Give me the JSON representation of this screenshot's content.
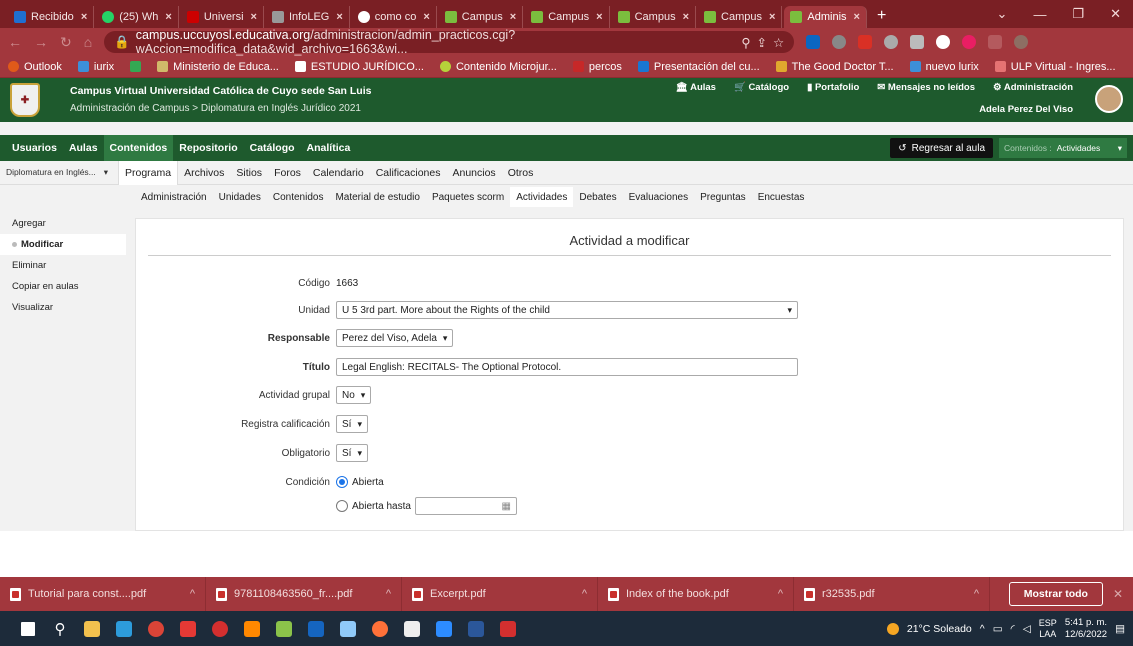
{
  "browser": {
    "tabs": [
      {
        "label": "Recibido",
        "color": "#7a7a7a",
        "active": false
      },
      {
        "label": "(25) Wh",
        "color": "#25d366",
        "active": false
      },
      {
        "label": "Universi",
        "color": "#c00",
        "active": false
      },
      {
        "label": "InfoLEG",
        "color": "#888",
        "active": false
      },
      {
        "label": "como co",
        "color": "#fff",
        "active": false
      },
      {
        "label": "Campus",
        "color": "#5a9e3a",
        "active": false
      },
      {
        "label": "Campus",
        "color": "#5a9e3a",
        "active": false
      },
      {
        "label": "Campus",
        "color": "#5a9e3a",
        "active": false
      },
      {
        "label": "Campus",
        "color": "#5a9e3a",
        "active": false
      },
      {
        "label": "Adminis",
        "color": "#5a9e3a",
        "active": true
      }
    ],
    "url_host": "campus.uccuyosl.educativa.org",
    "url_path": "/administracion/admin_practicos.cgi?wAccion=modifica_data&wid_archivo=1663&wi...",
    "bookmarks": [
      "Outlook",
      "iurix",
      "",
      "Ministerio de Educa...",
      "ESTUDIO JURÍDICO...",
      "Contenido Microjur...",
      "percos",
      "Presentación del cu...",
      "The Good Doctor T...",
      "nuevo lurix",
      "ULP Virtual - Ingres..."
    ]
  },
  "header": {
    "site_name": "Campus Virtual Universidad Católica de Cuyo sede San Luis",
    "breadcrumb": "Administración de Campus > Diplomatura en Inglés Jurídico 2021",
    "nav": [
      "Aulas",
      "Catálogo",
      "Portafolio",
      "Mensajes no leídos",
      "Administración"
    ],
    "user": "Adela Perez Del Viso"
  },
  "main_menu": {
    "items": [
      "Usuarios",
      "Aulas",
      "Contenidos",
      "Repositorio",
      "Catálogo",
      "Analítica"
    ],
    "active": "Contenidos",
    "back_label": "Regresar al aula",
    "context_label": "Contenidos :",
    "context_value": "Actividades"
  },
  "sub_menu": {
    "course": "Diplomatura en Inglés...",
    "items": [
      "Programa",
      "Archivos",
      "Sitios",
      "Foros",
      "Calendario",
      "Calificaciones",
      "Anuncios",
      "Otros"
    ],
    "active": "Programa"
  },
  "sub_sub_menu": {
    "items": [
      "Administración",
      "Unidades",
      "Contenidos",
      "Material de estudio",
      "Paquetes scorm",
      "Actividades",
      "Debates",
      "Evaluaciones",
      "Preguntas",
      "Encuestas"
    ],
    "active": "Actividades"
  },
  "sidebar": {
    "items": [
      "Agregar",
      "Modificar",
      "Eliminar",
      "Copiar en aulas",
      "Visualizar"
    ],
    "active": "Modificar"
  },
  "form": {
    "title": "Actividad a modificar",
    "codigo_label": "Código",
    "codigo_value": "1663",
    "unidad_label": "Unidad",
    "unidad_value": "U 5 3rd part. More about the Rights of the child",
    "responsable_label": "Responsable",
    "responsable_value": "Perez del Viso, Adela",
    "titulo_label": "Título",
    "titulo_value": "Legal English: RECITALS- The Optional Protocol.",
    "grupal_label": "Actividad grupal",
    "grupal_value": "No",
    "calif_label": "Registra calificación",
    "calif_value": "Sí",
    "oblig_label": "Obligatorio",
    "oblig_value": "Sí",
    "condicion_label": "Condición",
    "condicion_opt1": "Abierta",
    "condicion_opt2": "Abierta hasta"
  },
  "downloads": {
    "items": [
      "Tutorial para const....pdf",
      "9781108463560_fr....pdf",
      "Excerpt.pdf",
      "Index of the book.pdf",
      "r32535.pdf"
    ],
    "show_all": "Mostrar todo"
  },
  "taskbar": {
    "weather": "21°C Soleado",
    "lang1": "ESP",
    "lang2": "LAA",
    "time": "5:41 p. m.",
    "date": "12/6/2022"
  }
}
